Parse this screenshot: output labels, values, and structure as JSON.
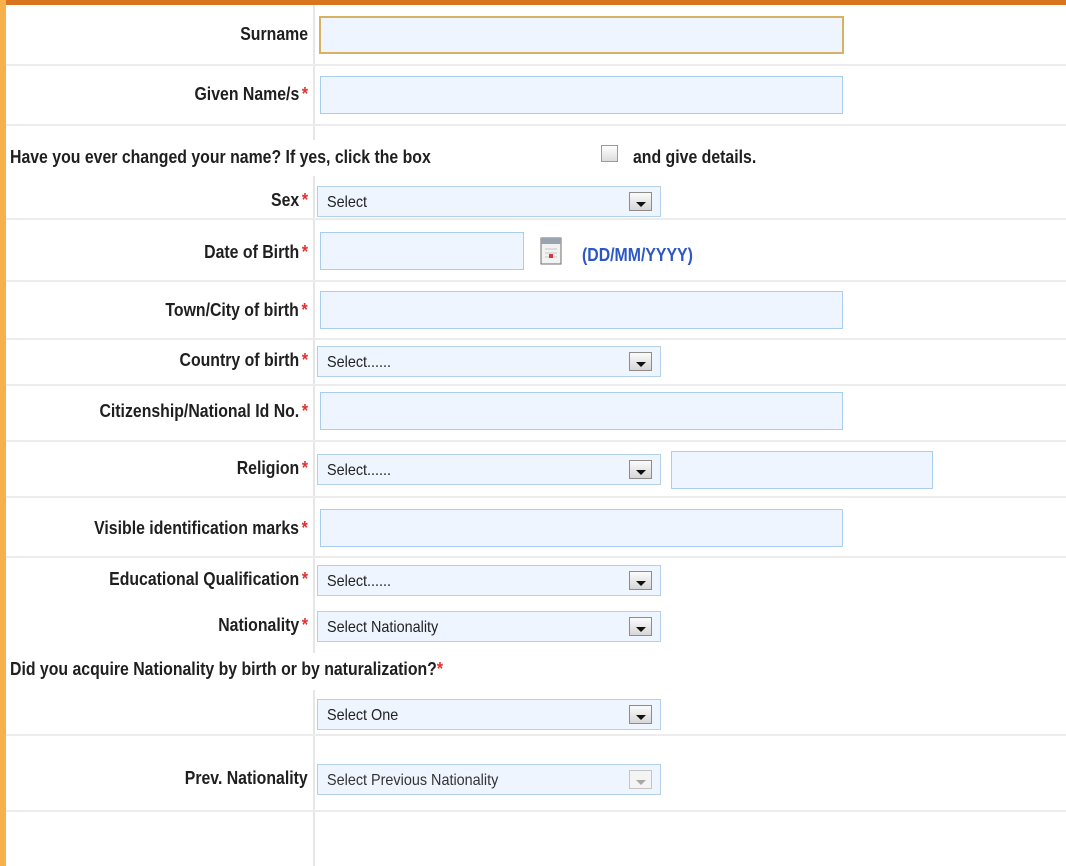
{
  "form": {
    "surname": {
      "label": "Surname",
      "value": ""
    },
    "given_names": {
      "label": "Given Name/s",
      "required": "*",
      "value": ""
    },
    "name_change": {
      "text_before": "Have you ever changed your name? If yes, click the box",
      "text_after": "and give details.",
      "checked": false
    },
    "sex": {
      "label": "Sex",
      "required": "*",
      "selected": "Select"
    },
    "dob": {
      "label": "Date of Birth",
      "required": "*",
      "value": "",
      "format_hint": "(DD/MM/YYYY)",
      "calendar_icon": "calendar-icon"
    },
    "town_city": {
      "label": "Town/City of birth",
      "required": "*",
      "value": ""
    },
    "country_of_birth": {
      "label": "Country of birth",
      "required": "*",
      "selected": "Select......"
    },
    "citizenship_id": {
      "label": "Citizenship/National Id No.",
      "required": "*",
      "value": ""
    },
    "religion": {
      "label": "Religion",
      "required": "*",
      "selected": "Select......",
      "other_value": ""
    },
    "identification_marks": {
      "label": "Visible identification marks",
      "required": "*",
      "value": ""
    },
    "education": {
      "label": "Educational Qualification",
      "required": "*",
      "selected": "Select......"
    },
    "nationality": {
      "label": "Nationality",
      "required": "*",
      "selected": "Select Nationality"
    },
    "acquired_by": {
      "question": "Did you acquire Nationality by birth or by naturalization?",
      "required": "*",
      "selected": "Select One"
    },
    "prev_nationality": {
      "label": "Prev. Nationality",
      "selected": "Select Previous Nationality",
      "disabled": true
    }
  },
  "colors": {
    "top_bar": "#d9741f",
    "left_stripe": "#f7b04a",
    "field_bg": "#eef5ff",
    "field_border": "#a9cdee",
    "required_mark": "#e03030",
    "hint_text": "#2d57c4"
  }
}
